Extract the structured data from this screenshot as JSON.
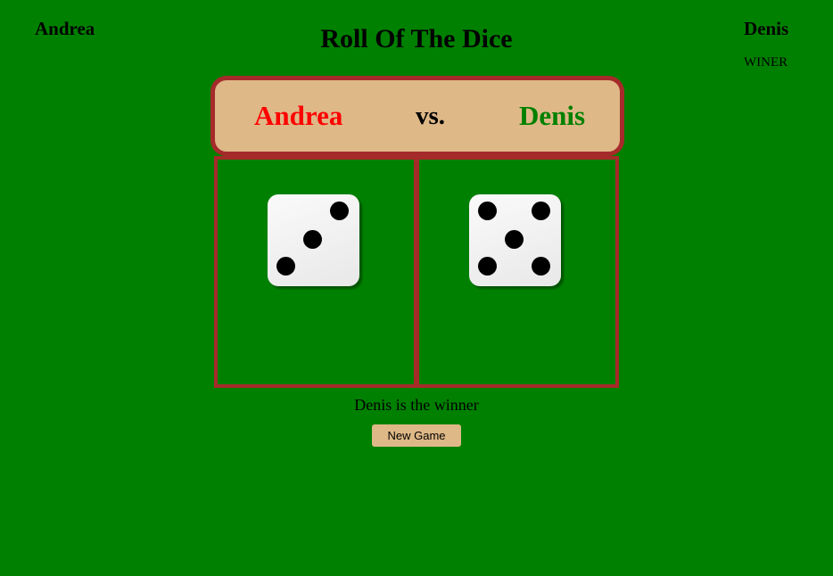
{
  "game": {
    "title": "Roll Of The Dice",
    "player1": {
      "name": "Andrea",
      "color": "#ff0000",
      "die_value": 3
    },
    "player2": {
      "name": "Denis",
      "color": "#008000",
      "die_value": 5
    },
    "vs_label": "vs.",
    "winner_tag": "WINER",
    "result_text": "Denis is the winner",
    "new_game_label": "New Game"
  },
  "theme": {
    "background": "#008000",
    "panel_color": "#deb887",
    "border_color": "#a52a2a"
  }
}
